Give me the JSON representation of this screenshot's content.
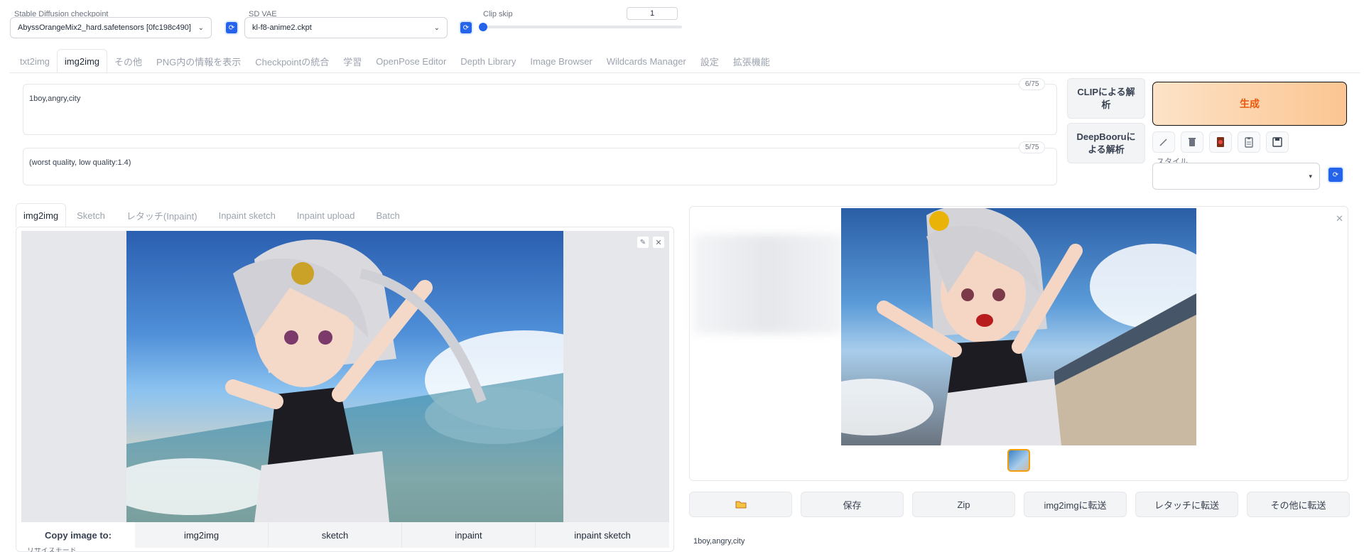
{
  "top": {
    "checkpoint_label": "Stable Diffusion checkpoint",
    "checkpoint_value": "AbyssOrangeMix2_hard.safetensors [0fc198c490]",
    "vae_label": "SD VAE",
    "vae_value": "kl-f8-anime2.ckpt",
    "clip_label": "Clip skip",
    "clip_value": "1"
  },
  "main_tabs": [
    "txt2img",
    "img2img",
    "その他",
    "PNG内の情報を表示",
    "Checkpointの統合",
    "学習",
    "OpenPose Editor",
    "Depth Library",
    "Image Browser",
    "Wildcards Manager",
    "設定",
    "拡張機能"
  ],
  "prompt": {
    "text": "1boy,angry,city",
    "counter": "6/75"
  },
  "negative": {
    "text": "(worst quality, low quality:1.4)",
    "counter": "5/75"
  },
  "buttons": {
    "clip_interrogate": "CLIPによる解析",
    "deepbooru": "DeepBooruによる解析",
    "generate": "生成",
    "style_label": "スタイル"
  },
  "sub_tabs": [
    "img2img",
    "Sketch",
    "レタッチ(Inpaint)",
    "Inpaint sketch",
    "Inpaint upload",
    "Batch"
  ],
  "copy_image": {
    "label": "Copy image to:",
    "targets": [
      "img2img",
      "sketch",
      "inpaint",
      "inpaint sketch"
    ]
  },
  "resize_mode_label": "リサイズモード",
  "output_buttons": [
    "保存",
    "Zip",
    "img2imgに転送",
    "レタッチに転送",
    "その他に転送"
  ],
  "output_info": "1boy,angry,city",
  "colors": {
    "generate_bg": "#fcd0a6",
    "generate_text": "#ea580c",
    "accent_blue": "#2563eb"
  },
  "icons": [
    "refresh-icon",
    "chevron-down-icon",
    "pencil-icon",
    "trash-icon",
    "red-card-icon",
    "clipboard-icon",
    "save-icon",
    "folder-icon",
    "close-icon",
    "edit-icon"
  ]
}
